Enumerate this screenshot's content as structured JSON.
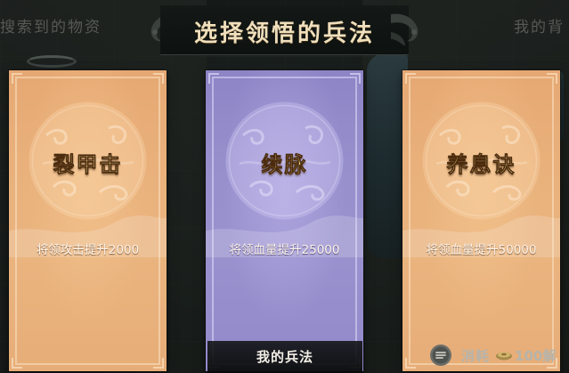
{
  "background": {
    "left_tab_label": "搜索到的物资",
    "right_tab_label": "我的背"
  },
  "dialog": {
    "title": "选择领悟的兵法"
  },
  "cards": [
    {
      "name": "裂甲击",
      "description": "将领攻击提升2000",
      "theme_color": "#e8ad78"
    },
    {
      "name": "续脉",
      "description": "将领血量提升25000",
      "theme_color": "#978fcc"
    },
    {
      "name": "养息诀",
      "description": "将领血量提升50000",
      "theme_color": "#e8ad78"
    }
  ],
  "footer": {
    "tab_label": "我的兵法",
    "cost_label": "消耗",
    "cost_value": "100解",
    "cost_icon": "coin-icon"
  },
  "colors": {
    "title_text": "#f0dfbc",
    "skill_name_text": "#fbe7a0"
  }
}
